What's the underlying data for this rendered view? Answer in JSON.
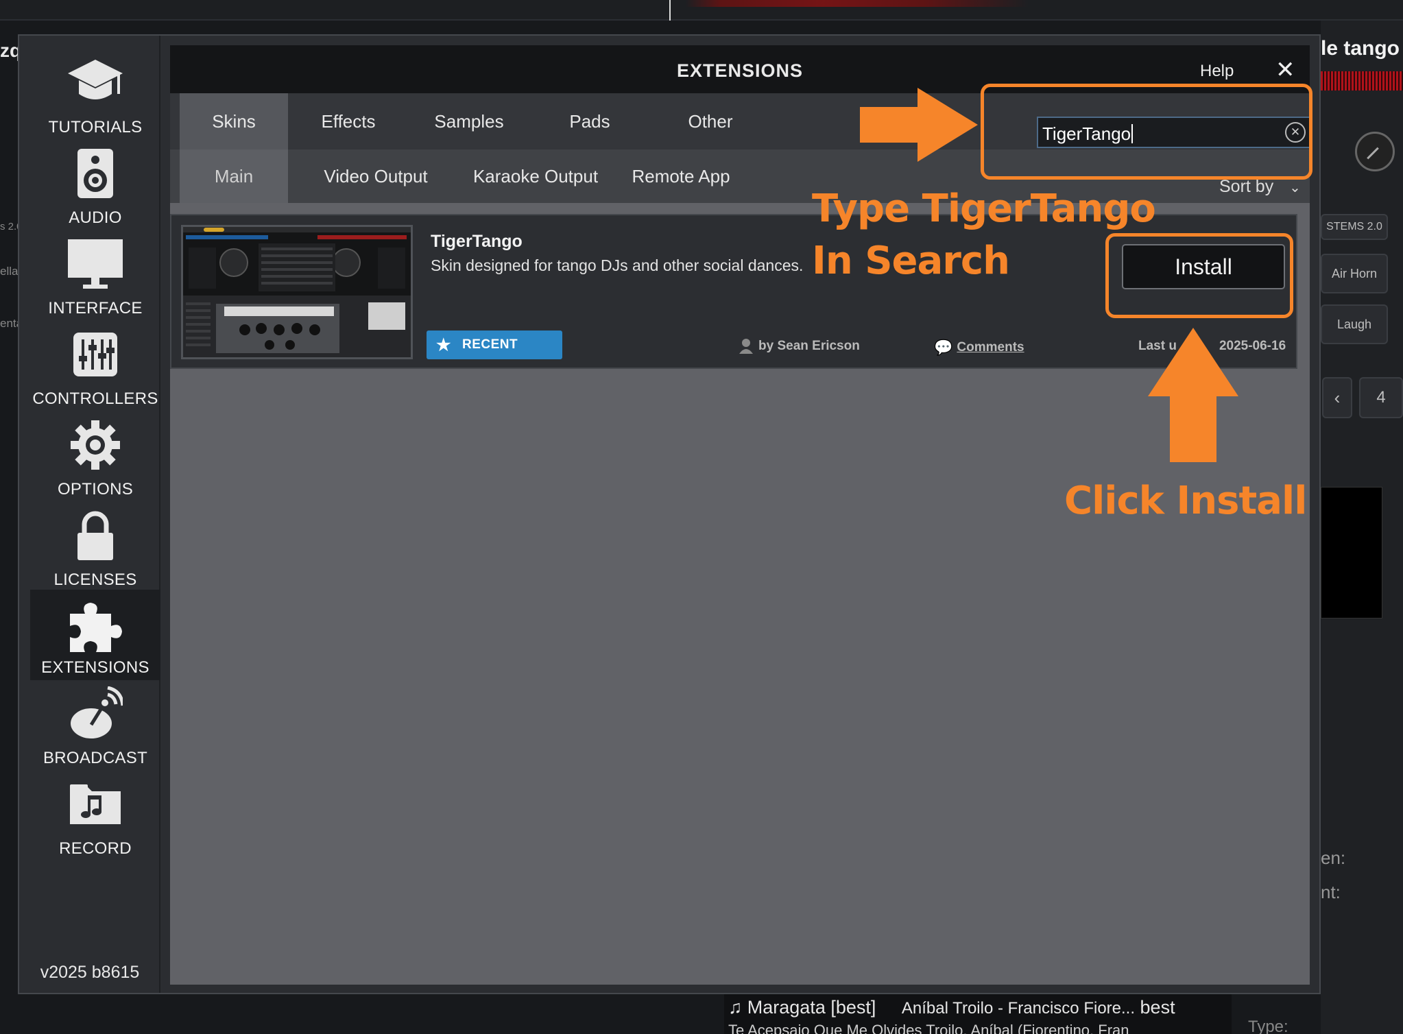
{
  "background": {
    "left_title": "zq",
    "right_title": "le tango -",
    "pads": [
      "STEMS 2.0",
      "Air Horn",
      "Laugh",
      "4"
    ],
    "side_labels": [
      "s 2.0",
      "ella)",
      "enta"
    ],
    "right_labels": [
      "en:",
      "nt:"
    ],
    "bottom_row1_title": "Maragata [best]",
    "bottom_row1_artist": "Aníbal Troilo - Francisco Fiore...",
    "bottom_row1_tag": "best",
    "bottom_row2": "Te Acepsaio Que Me Olvides  Troilo, Aníbal (Fiorentino, Fran",
    "bottom_right_label": "Type:"
  },
  "sidebar": {
    "items": [
      {
        "label": "TUTORIALS",
        "icon": "graduation-cap-icon"
      },
      {
        "label": "AUDIO",
        "icon": "speaker-icon"
      },
      {
        "label": "INTERFACE",
        "icon": "monitor-icon"
      },
      {
        "label": "CONTROLLERS",
        "icon": "sliders-icon"
      },
      {
        "label": "OPTIONS",
        "icon": "gear-icon"
      },
      {
        "label": "LICENSES",
        "icon": "lock-icon"
      },
      {
        "label": "EXTENSIONS",
        "icon": "puzzle-icon",
        "active": true
      },
      {
        "label": "BROADCAST",
        "icon": "satellite-dish-icon"
      },
      {
        "label": "RECORD",
        "icon": "music-folder-icon"
      }
    ],
    "version": "v2025 b8615"
  },
  "header": {
    "title": "EXTENSIONS",
    "help": "Help",
    "close": "✕"
  },
  "tabs_primary": [
    {
      "label": "Skins",
      "active": true
    },
    {
      "label": "Effects"
    },
    {
      "label": "Samples"
    },
    {
      "label": "Pads"
    },
    {
      "label": "Other"
    }
  ],
  "tabs_secondary": [
    {
      "label": "Main",
      "active": true
    },
    {
      "label": "Video Output"
    },
    {
      "label": "Karaoke Output"
    },
    {
      "label": "Remote App"
    }
  ],
  "search": {
    "value": "TigerTango"
  },
  "sort": {
    "label": "Sort by"
  },
  "result": {
    "name": "TigerTango",
    "description": "Skin designed for tango DJs and other social dances.",
    "badge": "RECENT",
    "author": "by Sean Ericson",
    "comments": "Comments",
    "updated_prefix": "Last u",
    "updated_date": "2025-06-16",
    "install_label": "Install"
  },
  "annotations": {
    "search_hint_line1": "Type TigerTango",
    "search_hint_line2": "In Search",
    "install_hint": "Click Install",
    "color": "#f6852a"
  },
  "colors": {
    "accent_blue": "#2b86c5",
    "dialog_bg": "#2b2d31",
    "content_bg": "#616267"
  }
}
